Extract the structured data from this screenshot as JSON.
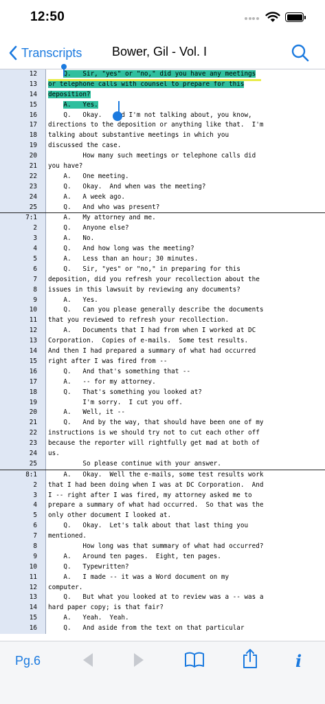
{
  "status": {
    "time": "12:50"
  },
  "nav": {
    "back_label": "Transcripts",
    "title": "Bower, Gil - Vol. I"
  },
  "toolbar": {
    "page_label": "Pg.6"
  },
  "pages": [
    {
      "lines": [
        {
          "n": "12",
          "t": "    Q.   Sir, \"yes\" or \"no,\" did you have any meetings"
        },
        {
          "n": "13",
          "t": "or telephone calls with counsel to prepare for this"
        },
        {
          "n": "14",
          "t": "deposition?"
        },
        {
          "n": "15",
          "t": "    A.   Yes."
        },
        {
          "n": "16",
          "t": "    Q.   Okay.   And I'm not talking about, you know,"
        },
        {
          "n": "17",
          "t": "directions to the deposition or anything like that.  I'm"
        },
        {
          "n": "18",
          "t": "talking about substantive meetings in which you"
        },
        {
          "n": "19",
          "t": "discussed the case."
        },
        {
          "n": "20",
          "t": "         How many such meetings or telephone calls did"
        },
        {
          "n": "21",
          "t": "you have?"
        },
        {
          "n": "22",
          "t": "    A.   One meeting."
        },
        {
          "n": "23",
          "t": "    Q.   Okay.  And when was the meeting?"
        },
        {
          "n": "24",
          "t": "    A.   A week ago."
        },
        {
          "n": "25",
          "t": "    Q.   And who was present?"
        }
      ]
    },
    {
      "lines": [
        {
          "n": "7:1",
          "t": "    A.   My attorney and me."
        },
        {
          "n": "2",
          "t": "    Q.   Anyone else?"
        },
        {
          "n": "3",
          "t": "    A.   No."
        },
        {
          "n": "4",
          "t": "    Q.   And how long was the meeting?"
        },
        {
          "n": "5",
          "t": "    A.   Less than an hour; 30 minutes."
        },
        {
          "n": "6",
          "t": "    Q.   Sir, \"yes\" or \"no,\" in preparing for this"
        },
        {
          "n": "7",
          "t": "deposition, did you refresh your recollection about the"
        },
        {
          "n": "8",
          "t": "issues in this lawsuit by reviewing any documents?"
        },
        {
          "n": "9",
          "t": "    A.   Yes."
        },
        {
          "n": "10",
          "t": "    Q.   Can you please generally describe the documents"
        },
        {
          "n": "11",
          "t": "that you reviewed to refresh your recollection."
        },
        {
          "n": "12",
          "t": "    A.   Documents that I had from when I worked at DC"
        },
        {
          "n": "13",
          "t": "Corporation.  Copies of e-mails.  Some test results."
        },
        {
          "n": "14",
          "t": "And then I had prepared a summary of what had occurred"
        },
        {
          "n": "15",
          "t": "right after I was fired from --"
        },
        {
          "n": "16",
          "t": "    Q.   And that's something that --"
        },
        {
          "n": "17",
          "t": "    A.   -- for my attorney."
        },
        {
          "n": "18",
          "t": "    Q.   That's something you looked at?"
        },
        {
          "n": "19",
          "t": "         I'm sorry.  I cut you off."
        },
        {
          "n": "20",
          "t": "    A.   Well, it --"
        },
        {
          "n": "21",
          "t": "    Q.   And by the way, that should have been one of my"
        },
        {
          "n": "22",
          "t": "instructions is we should try not to cut each other off"
        },
        {
          "n": "23",
          "t": "because the reporter will rightfully get mad at both of"
        },
        {
          "n": "24",
          "t": "us."
        },
        {
          "n": "25",
          "t": "         So please continue with your answer."
        }
      ]
    },
    {
      "lines": [
        {
          "n": "8:1",
          "t": "    A.   Okay.  Well the e-mails, some test results work"
        },
        {
          "n": "2",
          "t": "that I had been doing when I was at DC Corporation.  And"
        },
        {
          "n": "3",
          "t": "I -- right after I was fired, my attorney asked me to"
        },
        {
          "n": "4",
          "t": "prepare a summary of what had occurred.  So that was the"
        },
        {
          "n": "5",
          "t": "only other document I looked at."
        },
        {
          "n": "6",
          "t": "    Q.   Okay.  Let's talk about that last thing you"
        },
        {
          "n": "7",
          "t": "mentioned."
        },
        {
          "n": "8",
          "t": "         How long was that summary of what had occurred?"
        },
        {
          "n": "9",
          "t": "    A.   Around ten pages.  Eight, ten pages."
        },
        {
          "n": "10",
          "t": "    Q.   Typewritten?"
        },
        {
          "n": "11",
          "t": "    A.   I made -- it was a Word document on my"
        },
        {
          "n": "12",
          "t": "computer."
        },
        {
          "n": "13",
          "t": "    Q.   But what you looked at to review was a -- was a"
        },
        {
          "n": "14",
          "t": "hard paper copy; is that fair?"
        },
        {
          "n": "15",
          "t": "    A.   Yeah.  Yeah."
        },
        {
          "n": "16",
          "t": "    Q.   And aside from the text on that particular"
        }
      ]
    }
  ],
  "highlight": {
    "page": 0,
    "lines": [
      0,
      1,
      2,
      3
    ],
    "color": "#2fbf9e"
  },
  "colors": {
    "accent": "#1b7adf",
    "gutter": "#dfe7f4",
    "highlight": "#2fbf9e"
  },
  "icons": {
    "back": "chevron-left-icon",
    "search": "magnifier-icon",
    "prev": "triangle-left-icon",
    "next": "triangle-right-icon",
    "book": "open-book-icon",
    "share": "share-icon",
    "info": "info-icon"
  }
}
